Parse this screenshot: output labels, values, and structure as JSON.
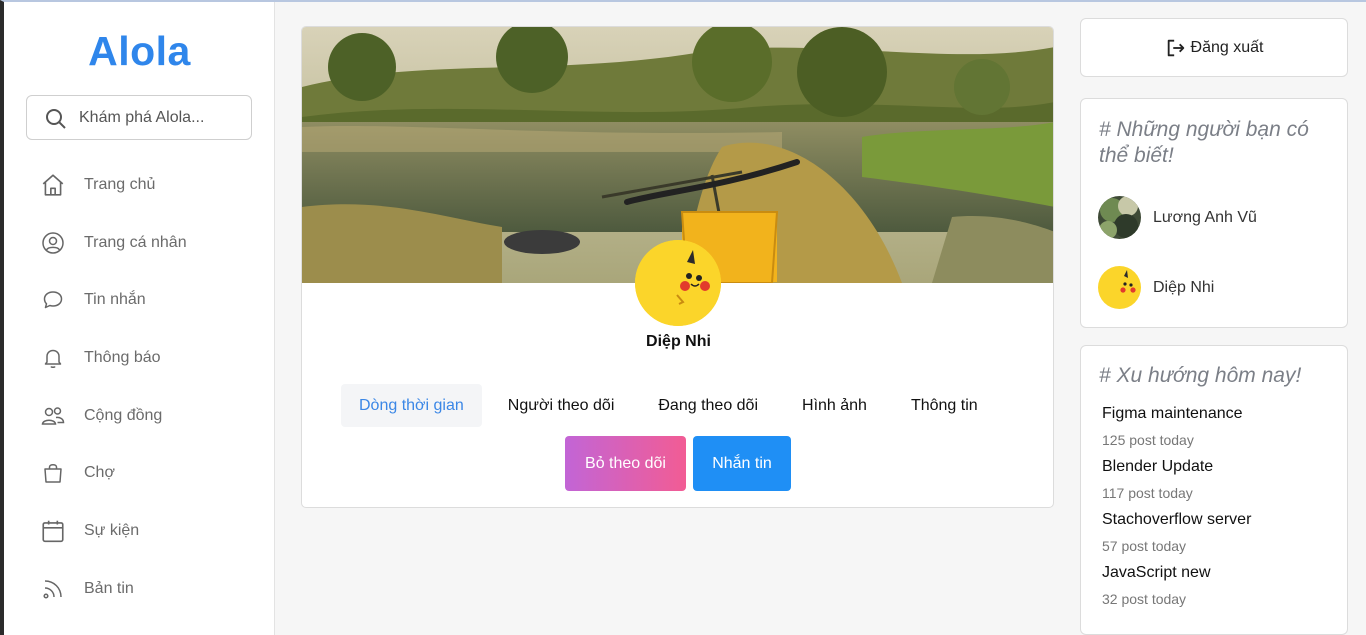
{
  "app": {
    "logo": "Alola"
  },
  "search": {
    "placeholder": "Khám phá Alola..."
  },
  "sidebar": {
    "items": [
      {
        "label": "Trang chủ",
        "icon": "home-icon"
      },
      {
        "label": "Trang cá nhân",
        "icon": "user-circle-icon"
      },
      {
        "label": "Tin nhắn",
        "icon": "message-icon"
      },
      {
        "label": "Thông báo",
        "icon": "bell-icon"
      },
      {
        "label": "Cộng đồng",
        "icon": "users-icon"
      },
      {
        "label": "Chợ",
        "icon": "shopping-bag-icon"
      },
      {
        "label": "Sự kiện",
        "icon": "calendar-icon"
      },
      {
        "label": "Bản tin",
        "icon": "rss-icon"
      }
    ]
  },
  "profile": {
    "name": "Diệp Nhi",
    "tabs": [
      "Dòng thời gian",
      "Người theo dõi",
      "Đang theo dõi",
      "Hình ảnh",
      "Thông tin"
    ],
    "active_tab": "Dòng thời gian",
    "unfollow_label": "Bỏ theo dõi",
    "message_label": "Nhắn tin"
  },
  "logout": {
    "label": "Đăng xuất",
    "icon": "logout-icon"
  },
  "suggestions": {
    "title": "# Những người bạn có thể biết!",
    "people": [
      {
        "name": "Lương Anh Vũ"
      },
      {
        "name": "Diệp Nhi"
      }
    ]
  },
  "trends": {
    "title": "# Xu hướng hôm nay!",
    "items": [
      {
        "topic": "Figma maintenance",
        "count": "125 post today"
      },
      {
        "topic": "Blender Update",
        "count": "117 post today"
      },
      {
        "topic": "Stachoverflow server",
        "count": "57 post today"
      },
      {
        "topic": "JavaScript new",
        "count": "32 post today"
      }
    ]
  },
  "colors": {
    "accent": "#2f86eb",
    "active_tab_text": "#3b87e6",
    "message_button": "#1f8ff5",
    "unfollow_gradient_start": "#c265d6",
    "unfollow_gradient_end": "#f25c94",
    "avatar_yellow": "#fbd52a"
  }
}
